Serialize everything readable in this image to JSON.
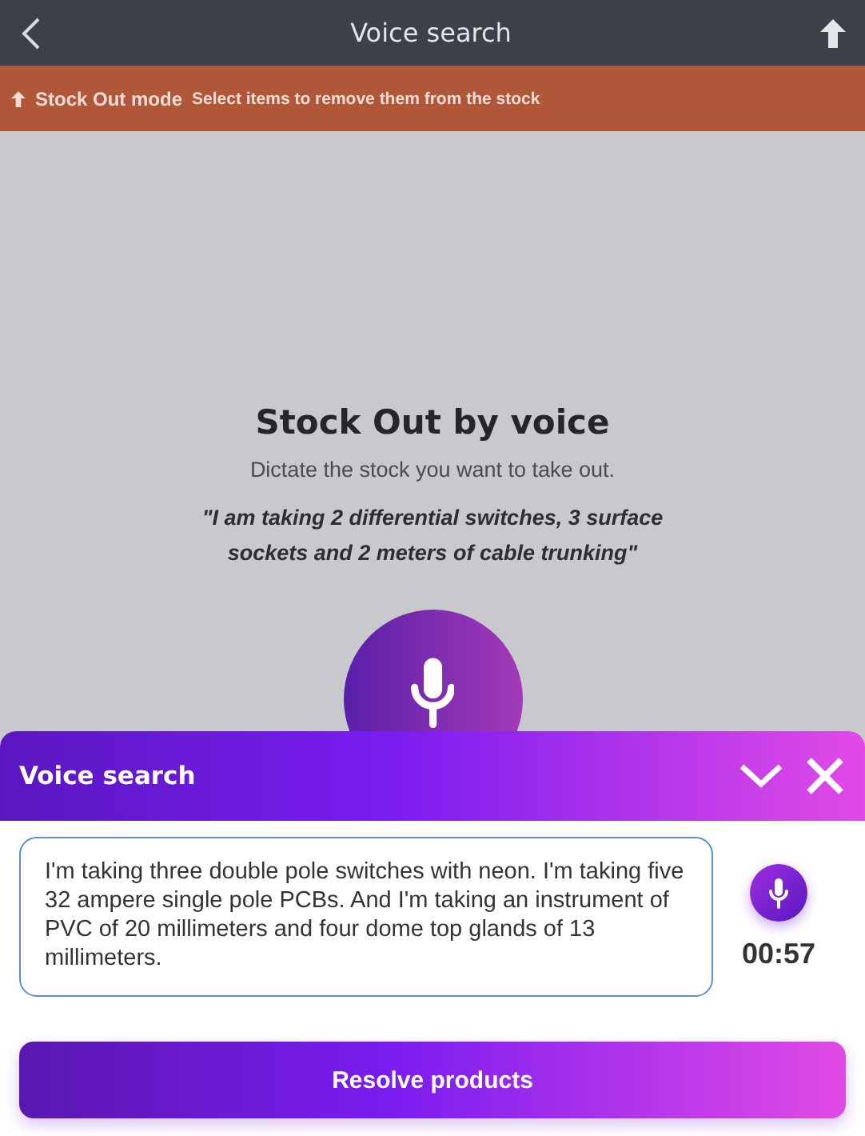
{
  "header": {
    "title": "Voice search"
  },
  "banner": {
    "mode": "Stock Out mode",
    "hint": "Select items to remove them from the stock"
  },
  "intro": {
    "title": "Stock Out by voice",
    "subtitle": "Dictate the stock you want to take out.",
    "example": "\"I am taking 2 differential switches, 3 surface sockets and 2 meters of cable trunking\""
  },
  "panel": {
    "title": "Voice search",
    "transcript": "I'm taking three double pole switches with neon. I'm taking five 32 ampere single pole PCBs. And I'm taking an instrument of PVC of 20 millimeters and four dome top glands of 13 millimeters.",
    "timer": "00:57",
    "button": "Resolve products"
  }
}
